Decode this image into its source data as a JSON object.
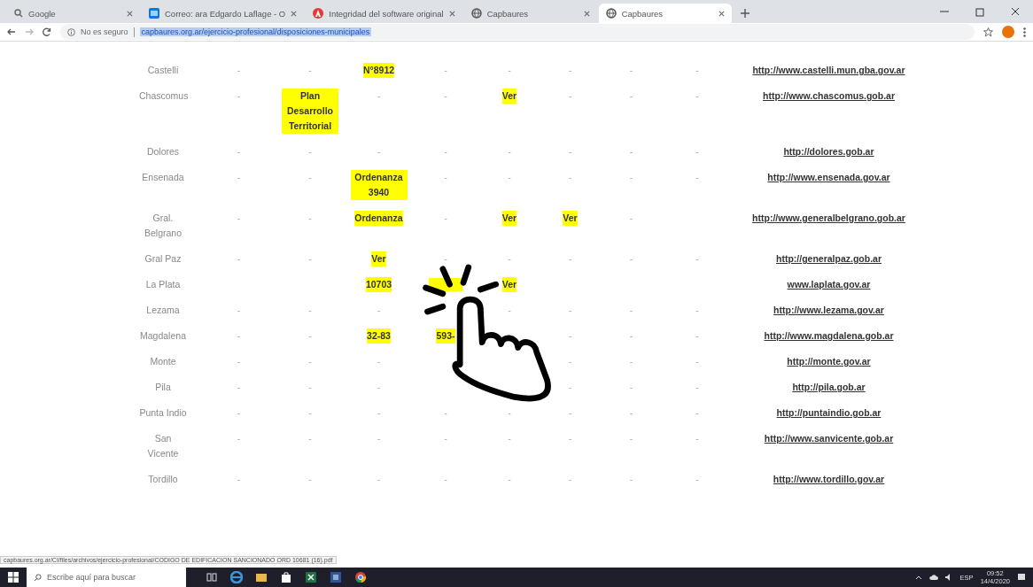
{
  "browser": {
    "tabs": [
      {
        "title": "Google",
        "selected": false
      },
      {
        "title": "Correo: ara Edgardo Laflage - O",
        "selected": false
      },
      {
        "title": "Integridad del software original",
        "selected": false
      },
      {
        "title": "Capbaures",
        "selected": false
      },
      {
        "title": "Capbaures",
        "selected": true
      }
    ],
    "security_label": "No es seguro",
    "url": "capbaures.org.ar/ejercicio-profesional/disposiciones-municipales"
  },
  "table": {
    "rows": [
      {
        "name": "Castelli",
        "cells": [
          {
            "kind": "dash",
            "text": "-"
          },
          {
            "kind": "dash",
            "text": "-"
          },
          {
            "kind": "mark",
            "text": "N°8912"
          },
          {
            "kind": "dash",
            "text": "-"
          },
          {
            "kind": "dash",
            "text": "-"
          },
          {
            "kind": "dash",
            "text": "-"
          },
          {
            "kind": "dash",
            "text": "-"
          },
          {
            "kind": "dash",
            "text": "-"
          }
        ],
        "link": "http://www.castelli.mun.gba.gov.ar"
      },
      {
        "name": "Chascomus",
        "cells": [
          {
            "kind": "dash",
            "text": "-"
          },
          {
            "kind": "mark",
            "text": "Plan Desarrollo Territorial"
          },
          {
            "kind": "dash",
            "text": "-"
          },
          {
            "kind": "dash",
            "text": "-"
          },
          {
            "kind": "mark",
            "text": "Ver"
          },
          {
            "kind": "dash",
            "text": "-"
          },
          {
            "kind": "dash",
            "text": "-"
          },
          {
            "kind": "dash",
            "text": "-"
          }
        ],
        "link": "http://www.chascomus.gob.ar"
      },
      {
        "name": "Dolores",
        "cells": [
          {
            "kind": "dash",
            "text": "-"
          },
          {
            "kind": "dash",
            "text": "-"
          },
          {
            "kind": "dash",
            "text": "-"
          },
          {
            "kind": "dash",
            "text": "-"
          },
          {
            "kind": "dash",
            "text": "-"
          },
          {
            "kind": "dash",
            "text": "-"
          },
          {
            "kind": "dash",
            "text": "-"
          },
          {
            "kind": "dash",
            "text": "-"
          }
        ],
        "link": "http://dolores.gob.ar"
      },
      {
        "name": "Ensenada",
        "cells": [
          {
            "kind": "dash",
            "text": "-"
          },
          {
            "kind": "dash",
            "text": "-"
          },
          {
            "kind": "mark",
            "text": "Ordenanza 3940"
          },
          {
            "kind": "dash",
            "text": "-"
          },
          {
            "kind": "dash",
            "text": "-"
          },
          {
            "kind": "dash",
            "text": "-"
          },
          {
            "kind": "dash",
            "text": "-"
          },
          {
            "kind": "dash",
            "text": "-"
          }
        ],
        "link": "http://www.ensenada.gov.ar"
      },
      {
        "name": "Gral. Belgrano",
        "cells": [
          {
            "kind": "dash",
            "text": "-"
          },
          {
            "kind": "dash",
            "text": "-"
          },
          {
            "kind": "mark",
            "text": "Ordenanza"
          },
          {
            "kind": "dash",
            "text": "-"
          },
          {
            "kind": "mark",
            "text": "Ver"
          },
          {
            "kind": "mark",
            "text": "Ver"
          },
          {
            "kind": "dash",
            "text": "-"
          },
          {
            "kind": "blank"
          }
        ],
        "link": "http://www.generalbelgrano.gob.ar"
      },
      {
        "name": "Gral Paz",
        "cells": [
          {
            "kind": "dash",
            "text": "-"
          },
          {
            "kind": "dash",
            "text": "-"
          },
          {
            "kind": "mark",
            "text": "Ver"
          },
          {
            "kind": "dash",
            "text": "-"
          },
          {
            "kind": "dash",
            "text": "-"
          },
          {
            "kind": "dash",
            "text": "-"
          },
          {
            "kind": "dash",
            "text": "-"
          },
          {
            "kind": "dash",
            "text": "-"
          }
        ],
        "link": "http://generalpaz.gob.ar"
      },
      {
        "name": "La Plata",
        "cells": [
          {
            "kind": "blank"
          },
          {
            "kind": "blank"
          },
          {
            "kind": "mark",
            "text": "10703"
          },
          {
            "kind": "covered"
          },
          {
            "kind": "mark",
            "text": "Ver"
          },
          {
            "kind": "blank"
          },
          {
            "kind": "blank"
          },
          {
            "kind": "blank"
          }
        ],
        "link": "www.laplata.gov.ar"
      },
      {
        "name": "Lezama",
        "cells": [
          {
            "kind": "dash",
            "text": "-"
          },
          {
            "kind": "dash",
            "text": "-"
          },
          {
            "kind": "dash",
            "text": "-"
          },
          {
            "kind": "blank"
          },
          {
            "kind": "dash",
            "text": "-"
          },
          {
            "kind": "dash",
            "text": "-"
          },
          {
            "kind": "dash",
            "text": "-"
          },
          {
            "kind": "dash",
            "text": "-"
          }
        ],
        "link": "http://www.lezama.gov.ar"
      },
      {
        "name": "Magdalena",
        "cells": [
          {
            "kind": "dash",
            "text": "-"
          },
          {
            "kind": "dash",
            "text": "-"
          },
          {
            "kind": "mark",
            "text": "32-83"
          },
          {
            "kind": "mark",
            "text": "593-"
          },
          {
            "kind": "blank"
          },
          {
            "kind": "dash",
            "text": "-"
          },
          {
            "kind": "dash",
            "text": "-"
          },
          {
            "kind": "dash",
            "text": "-"
          }
        ],
        "link": "http://www.magdalena.gob.ar"
      },
      {
        "name": "Monte",
        "cells": [
          {
            "kind": "dash",
            "text": "-"
          },
          {
            "kind": "dash",
            "text": "-"
          },
          {
            "kind": "dash",
            "text": "-"
          },
          {
            "kind": "blank"
          },
          {
            "kind": "blank"
          },
          {
            "kind": "dash",
            "text": "-"
          },
          {
            "kind": "dash",
            "text": "-"
          },
          {
            "kind": "dash",
            "text": "-"
          }
        ],
        "link": "http://monte.gov.ar"
      },
      {
        "name": "Pila",
        "cells": [
          {
            "kind": "dash",
            "text": "-"
          },
          {
            "kind": "dash",
            "text": "-"
          },
          {
            "kind": "dash",
            "text": "-"
          },
          {
            "kind": "blank"
          },
          {
            "kind": "blank"
          },
          {
            "kind": "dash",
            "text": "-"
          },
          {
            "kind": "dash",
            "text": "-"
          },
          {
            "kind": "dash",
            "text": "-"
          }
        ],
        "link": "http://pila.gob.ar"
      },
      {
        "name": "Punta Indio",
        "cells": [
          {
            "kind": "dash",
            "text": "-"
          },
          {
            "kind": "dash",
            "text": "-"
          },
          {
            "kind": "dash",
            "text": "-"
          },
          {
            "kind": "dash",
            "text": "-"
          },
          {
            "kind": "dash",
            "text": "-"
          },
          {
            "kind": "dash",
            "text": "-"
          },
          {
            "kind": "dash",
            "text": "-"
          },
          {
            "kind": "dash",
            "text": "-"
          }
        ],
        "link": "http://puntaindio.gob.ar"
      },
      {
        "name": "San Vicente",
        "cells": [
          {
            "kind": "dash",
            "text": "-"
          },
          {
            "kind": "dash",
            "text": "-"
          },
          {
            "kind": "dash",
            "text": "-"
          },
          {
            "kind": "dash",
            "text": "-"
          },
          {
            "kind": "dash",
            "text": "-"
          },
          {
            "kind": "dash",
            "text": "-"
          },
          {
            "kind": "dash",
            "text": "-"
          },
          {
            "kind": "dash",
            "text": "-"
          }
        ],
        "link": "http://www.sanvicente.gob.ar"
      },
      {
        "name": "Tordillo",
        "cells": [
          {
            "kind": "dash",
            "text": "-"
          },
          {
            "kind": "dash",
            "text": "-"
          },
          {
            "kind": "dash",
            "text": "-"
          },
          {
            "kind": "dash",
            "text": "-"
          },
          {
            "kind": "dash",
            "text": "-"
          },
          {
            "kind": "dash",
            "text": "-"
          },
          {
            "kind": "dash",
            "text": "-"
          },
          {
            "kind": "dash",
            "text": "-"
          }
        ],
        "link": "http://www.tordillo.gov.ar"
      }
    ]
  },
  "status_url": "capbaures.org.ar/CI/files/archivos/ejercicio-profesional/CODIGO DE EDIFICACION SANCIONADO ORD 10681 (16).pdf",
  "taskbar": {
    "search_placeholder": "Escribe aquí para buscar",
    "language": "ESP",
    "time": "09:52",
    "date": "14/4/2020"
  }
}
